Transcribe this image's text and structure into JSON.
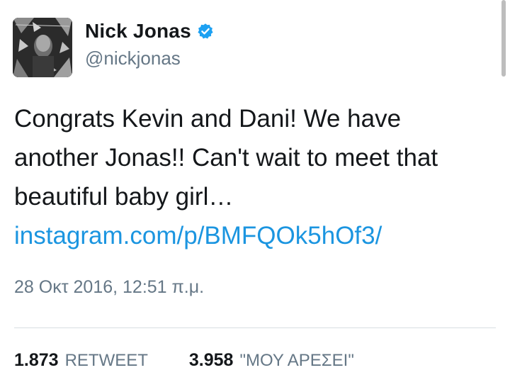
{
  "tweet": {
    "author": {
      "display_name": "Nick Jonas",
      "handle": "@nickjonas",
      "verified": true,
      "verified_color": "#1da1f2"
    },
    "text_lines": [
      "Congrats Kevin and Dani! We have",
      "another Jonas!! Can't wait to meet that",
      "beautiful baby girl…"
    ],
    "link": "instagram.com/p/BMFQOk5hOf3/",
    "timestamp": "28 Οκτ 2016, 12:51 π.μ.",
    "stats": {
      "retweets_count": "1.873",
      "retweets_label": "RETWEET",
      "likes_count": "3.958",
      "likes_label": "\"ΜΟΥ ΑΡΕΣΕΙ\""
    }
  },
  "colors": {
    "link": "#1b95e0",
    "secondary_text": "#657786",
    "primary_text": "#14171a"
  }
}
